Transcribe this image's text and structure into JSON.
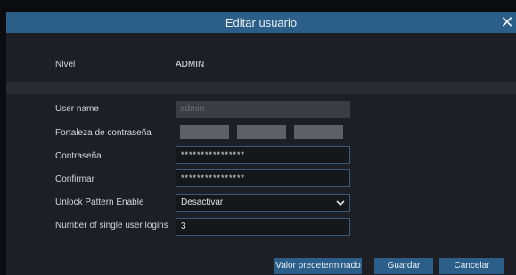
{
  "dialog": {
    "title": "Editar usuario",
    "close_icon": "close-icon"
  },
  "form": {
    "level_label": "Nivel",
    "level_value": "ADMIN",
    "username_label": "User name",
    "username_value": "admin",
    "strength_label": "Fortaleza de contraseña",
    "password_label": "Contraseña",
    "password_value": "****************",
    "confirm_label": "Confirmar",
    "confirm_value": "****************",
    "pattern_label": "Unlock Pattern Enable",
    "pattern_value": "Desactivar",
    "logins_label": "Number of single user logins",
    "logins_value": "3"
  },
  "buttons": {
    "default": "Valor predeterminado",
    "save": "Guardar",
    "cancel": "Cancelar"
  },
  "colors": {
    "title_bar": "#2b5f89",
    "panel": "#1e1f24",
    "input_border": "#355a7a"
  }
}
